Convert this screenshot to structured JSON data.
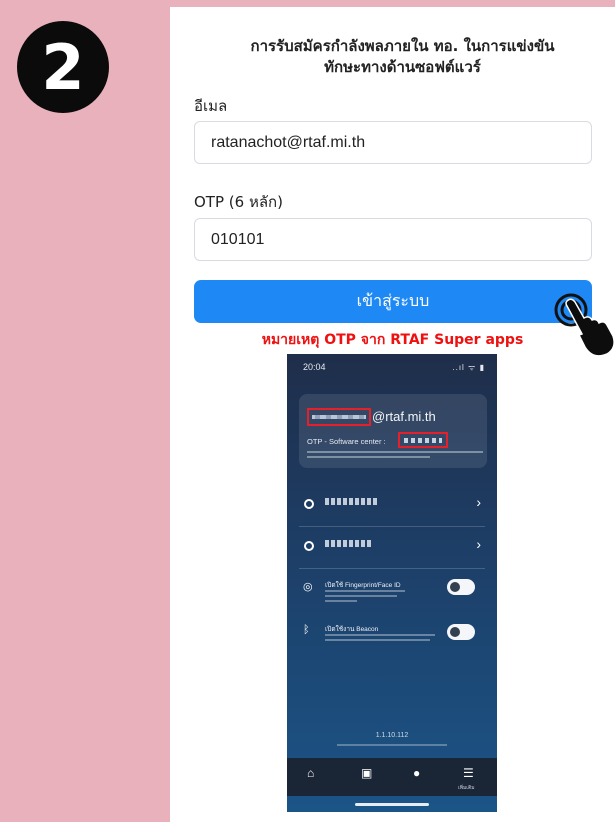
{
  "step": {
    "number": "2"
  },
  "form": {
    "title_line1": "การรับสมัครกำลังพลภายใน ทอ. ในการแข่งขัน",
    "title_line2": "ทักษะทางด้านซอฟต์แวร์",
    "email_label": "อีเมล",
    "email_value": "ratanachot@rtaf.mi.th",
    "otp_label": "OTP (6 หลัก)",
    "otp_value": "010101",
    "login_button": "เข้าสู่ระบบ",
    "note": "หมายเหตุ OTP จาก RTAF Super apps"
  },
  "phone": {
    "time": "20:04",
    "status_icons": "..ıl ᯤ ▮",
    "email_domain": "@rtaf.mi.th",
    "otp_label": "OTP - Software center :",
    "version": "1.1.10.112",
    "menu": {
      "fingerprint_title": "เปิดใช้ Fingerprint/Face ID",
      "beacon_title": "เปิดใช้งาน Beacon"
    },
    "nav_more_label": "เพิ่มเติม"
  },
  "colors": {
    "background": "#e8b1bb",
    "primary_button": "#1e88f5",
    "note_text": "#ef1010",
    "highlight_box": "#e5202a"
  }
}
